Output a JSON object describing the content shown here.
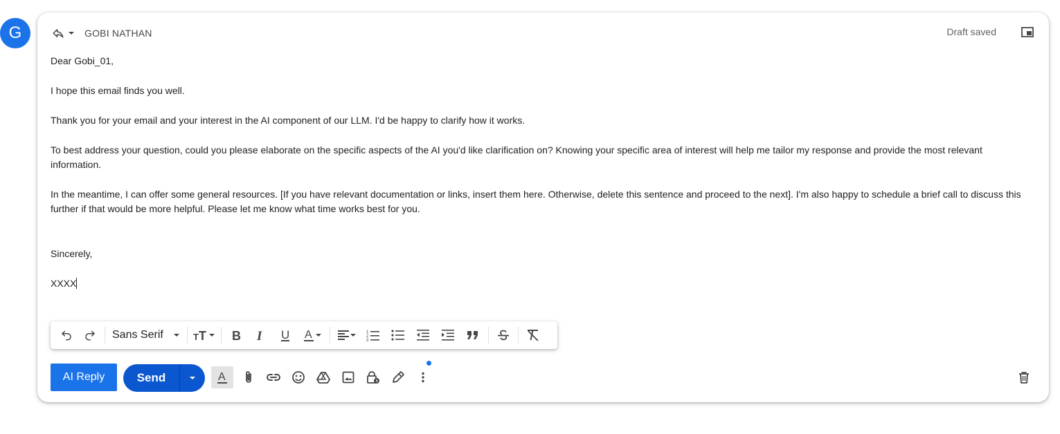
{
  "avatar": {
    "initial": "G"
  },
  "header": {
    "reply_icon": "reply-icon",
    "recipient": "GOBI NATHAN",
    "draft_status": "Draft saved",
    "popout_icon": "popout-icon"
  },
  "message": {
    "greeting": "Dear Gobi_01,",
    "paragraphs": [
      "I hope this email finds you well.",
      "Thank you for your email and your interest in the AI component of our LLM. I'd be happy to clarify how it works.",
      "To best address your question, could you please elaborate on the specific aspects of the AI you'd like clarification on? Knowing your specific area of interest will help me tailor my response and provide the most relevant information.",
      "In the meantime, I can offer some general resources. [If you have relevant documentation or links, insert them here. Otherwise, delete this sentence and proceed to the next]. I'm also happy to schedule a brief call to discuss this further if that would be more helpful. Please let me know what time works best for you."
    ],
    "closing": "Sincerely,",
    "signature": "XXXX"
  },
  "format_toolbar": {
    "font": "Sans Serif",
    "icons": [
      "undo-icon",
      "redo-icon",
      "font-size-icon",
      "bold-icon",
      "italic-icon",
      "underline-icon",
      "text-color-icon",
      "align-icon",
      "numbered-list-icon",
      "bulleted-list-icon",
      "indent-less-icon",
      "indent-more-icon",
      "quote-icon",
      "strikethrough-icon",
      "remove-formatting-icon"
    ]
  },
  "actions": {
    "ai_reply": "AI Reply",
    "send": "Send"
  },
  "colors": {
    "accent": "#1a73e8",
    "send": "#0b57d0"
  }
}
